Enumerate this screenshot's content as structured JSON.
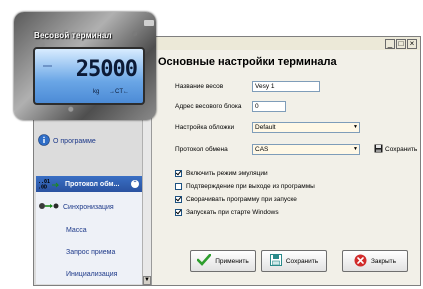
{
  "window": {
    "min_btn": "_",
    "max_btn": "□",
    "close_btn": "×"
  },
  "terminal": {
    "title": "Весовой терминал",
    "weight": "25000",
    "unit": "kg",
    "indicator": "→CT←"
  },
  "nav": {
    "about": "О программе",
    "group": "Протокол обм...",
    "items": [
      "Синхронизация",
      "Масса",
      "Запрос приема",
      "Инициализация"
    ]
  },
  "content": {
    "heading": "Основные настройки терминала",
    "fields": {
      "scale_name_label": "Название весов",
      "scale_name_value": "Vesy 1",
      "address_label": "Адрес весового блока",
      "address_value": "0",
      "skin_label": "Настройка обложки",
      "skin_value": "Default",
      "protocol_label": "Протокол обмена",
      "protocol_value": "CAS"
    },
    "save_inline": "Сохранить",
    "checkboxes": [
      {
        "label": "Включить режим эмуляции",
        "checked": true
      },
      {
        "label": "Подтверждение при выходе из программы",
        "checked": false
      },
      {
        "label": "Сворачивать программу при запуске",
        "checked": true
      },
      {
        "label": "Запускать при старте Windows",
        "checked": true
      }
    ],
    "buttons": {
      "apply": "Применить",
      "save": "Сохранить",
      "close": "Закрыть"
    }
  },
  "colors": {
    "accent": "#2a52a0",
    "apply_icon": "#2e9e2e",
    "close_icon": "#d12b2b"
  }
}
